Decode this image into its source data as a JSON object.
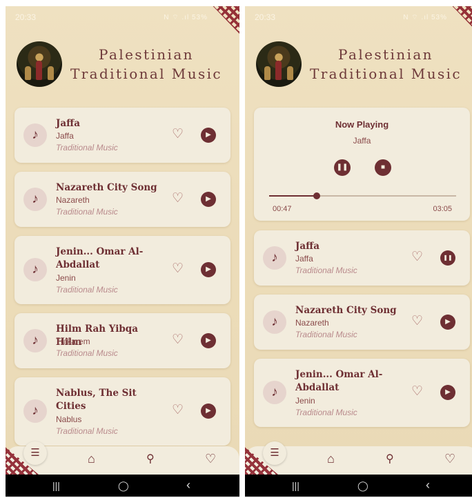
{
  "left": {
    "status_time": "20:33",
    "status_icons": "N ⌔ .ıl 53%",
    "title": "Palestinian Traditional Music",
    "songs": [
      {
        "title": "Jaffa",
        "city": "Jaffa",
        "genre": "Traditional Music"
      },
      {
        "title": "Nazareth City Song",
        "city": "Nazareth",
        "genre": "Traditional Music"
      },
      {
        "title": "Jenin... Omar Al-Abdallat",
        "city": "Jenin",
        "genre": "Traditional Music"
      },
      {
        "title": "Hilm Rah Yibqa Hilm",
        "city": "Tulkarem",
        "genre": "Traditional Music"
      },
      {
        "title": "Nablus, The Sit Cities",
        "city": "Nablus",
        "genre": "Traditional Music"
      }
    ]
  },
  "right": {
    "status_time": "20:33",
    "status_icons": "N ⌔ .ıl 53%",
    "title": "Palestinian Traditional Music",
    "now_playing": {
      "heading": "Now Playing",
      "song": "Jaffa",
      "current_time": "00:47",
      "total_time": "03:05",
      "progress": 0.254
    },
    "songs": [
      {
        "title": "Jaffa",
        "city": "Jaffa",
        "genre": "Traditional Music",
        "state": "playing"
      },
      {
        "title": "Nazareth City Song",
        "city": "Nazareth",
        "genre": "Traditional Music"
      },
      {
        "title": "Jenin... Omar Al-Abdallat",
        "city": "Jenin",
        "genre": "Traditional Music"
      }
    ]
  },
  "icons": {
    "note": "♪",
    "heart": "♡",
    "play": "▶",
    "pause": "❚❚",
    "stop": "■",
    "home": "⌂",
    "search": "⚲",
    "playlist": "☰",
    "recents": "|||",
    "home_button": "◯",
    "back": "‹"
  },
  "colors": {
    "accent": "#6e2f33",
    "background": "#ecdcb9",
    "card": "#f2ecdd"
  }
}
